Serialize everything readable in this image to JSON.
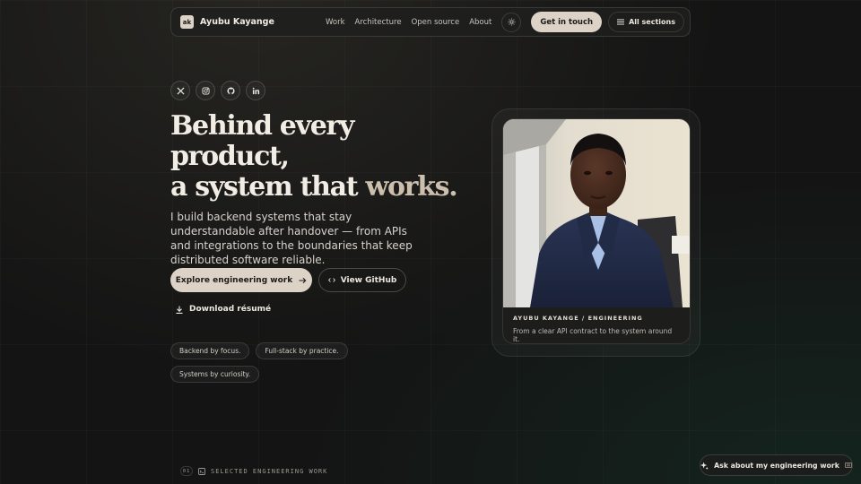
{
  "nav": {
    "logo_text": "ak",
    "brand_name": "Ayubu Kayange",
    "links": [
      "Work",
      "Architecture",
      "Open source",
      "About"
    ],
    "theme_icon": "sun-icon",
    "cta_label": "Get in touch",
    "sections_label": "All sections"
  },
  "socials": [
    "x-icon",
    "instagram-icon",
    "github-icon",
    "linkedin-icon"
  ],
  "hero": {
    "title_line1": "Behind every",
    "title_line2": "product,",
    "title_line3a": "a system that ",
    "title_line3b": "works.",
    "subtitle": "I build backend systems that stay understandable after handover — from APIs and integrations to the boundaries that keep distributed software reliable.",
    "primary_button": "Explore engineering work",
    "secondary_button": "View GitHub",
    "download_label": "Download résumé"
  },
  "chips": [
    "Backend by focus.",
    "Full-stack by practice.",
    "Systems by curiosity."
  ],
  "card": {
    "label": "AYUBU KAYANGE / ENGINEERING",
    "text": "From a clear API contract to the system around it."
  },
  "footer": {
    "section_number": "01",
    "section_label": "SELECTED ENGINEERING WORK",
    "ask_label": "Ask about my engineering work"
  },
  "colors": {
    "background": "#141414",
    "accent": "#ddd2c6",
    "text": "#f1ece4",
    "accent_word": "#cdbfae"
  }
}
